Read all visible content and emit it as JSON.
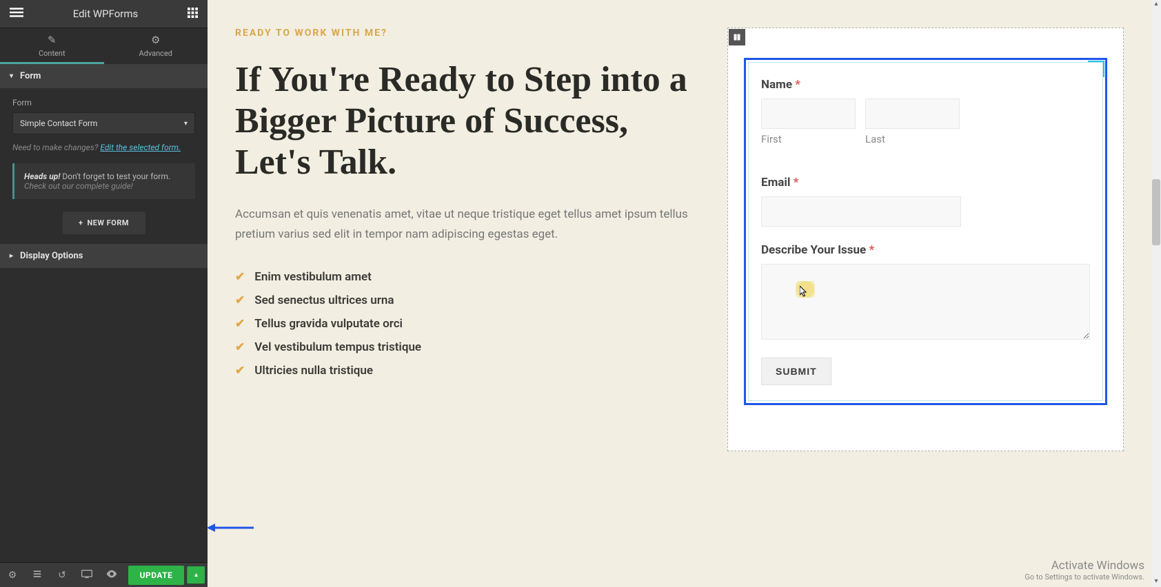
{
  "sidebar": {
    "title": "Edit WPForms",
    "tabs": {
      "content": "Content",
      "advanced": "Advanced"
    },
    "form_section": {
      "header": "Form",
      "field_label": "Form",
      "selected": "Simple Contact Form",
      "help_prefix": "Need to make changes? ",
      "help_link": "Edit the selected form.",
      "notice_strong": "Heads up!",
      "notice_rest": " Don't forget to test your form.",
      "notice_sub": "Check out our complete guide!",
      "new_form": "NEW FORM"
    },
    "display_section": {
      "header": "Display Options"
    },
    "footer": {
      "update": "UPDATE"
    }
  },
  "page": {
    "eyebrow": "READY TO WORK WITH ME?",
    "headline": "If You're Ready to Step into a Bigger Picture of Success, Let's Talk.",
    "body": "Accumsan et quis venenatis amet, vitae ut neque tristique eget tellus amet ipsum tellus pretium varius sed elit in tempor nam adipiscing egestas eget.",
    "checklist": [
      "Enim vestibulum amet",
      "Sed senectus ultrices urna",
      "Tellus gravida vulputate orci",
      "Vel vestibulum tempus tristique",
      "Ultricies nulla tristique"
    ]
  },
  "form": {
    "name_label": "Name ",
    "first": "First",
    "last": "Last",
    "email_label": "Email ",
    "describe_label": "Describe Your Issue ",
    "submit": "SUBMIT"
  },
  "watermark": {
    "line1": "Activate Windows",
    "line2": "Go to Settings to activate Windows."
  }
}
